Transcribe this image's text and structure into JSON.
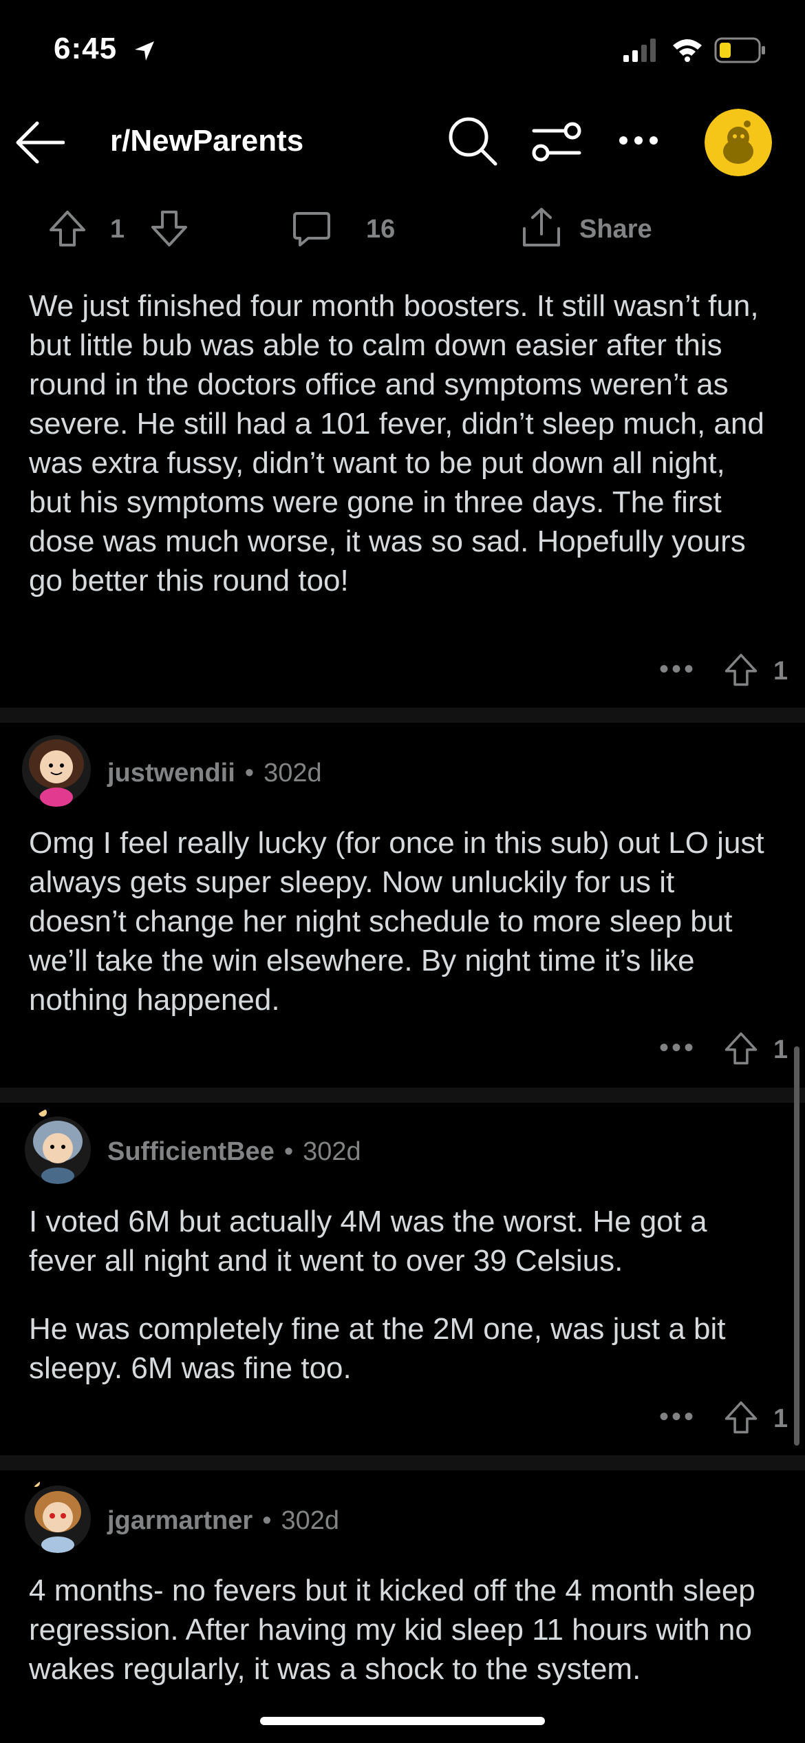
{
  "status_bar": {
    "time": "6:45",
    "icons": [
      "location-arrow-icon",
      "signal-icon",
      "wifi-icon",
      "battery-icon"
    ]
  },
  "header": {
    "back_icon": "back-arrow-icon",
    "title": "r/NewParents",
    "icons": [
      "search-icon",
      "filter-icon",
      "more-icon",
      "avatar"
    ],
    "accent": "#f5c518"
  },
  "post_actions": {
    "upvotes": "1",
    "comments": "16",
    "share_label": "Share"
  },
  "comments": [
    {
      "paragraphs": [
        "We just finished four month boosters. It still wasn’t fun, but little bub was able to calm down easier after this round in the doctors office and symptoms weren’t as severe. He still had a 101 fever, didn’t sleep much, and was extra fussy, didn’t want to be put down all night, but his symptoms were gone in three days. The first dose was much worse, it was so sad. Hopefully yours go better this round too!"
      ],
      "votes": "1",
      "more": "•••"
    },
    {
      "username": "justwendii",
      "age": "302d",
      "paragraphs": [
        "Omg I feel really lucky (for once in this sub) out LO just always gets super sleepy. Now unluckily for us it doesn’t change her night schedule to more sleep but we’ll take the win elsewhere. By night time it’s like nothing happened."
      ],
      "votes": "1",
      "more": "•••"
    },
    {
      "username": "SufficientBee",
      "age": "302d",
      "paragraphs": [
        "I voted 6M but actually 4M was the worst. He got a fever all night and it went to over 39 Celsius.",
        "He was completely fine at the 2M one, was just a bit sleepy. 6M was fine too."
      ],
      "votes": "1",
      "more": "•••"
    },
    {
      "username": "jgarmartner",
      "age": "302d",
      "paragraphs": [
        "4 months- no fevers but it kicked off the 4 month sleep regression. After having my kid sleep 11 hours with no wakes regularly, it was a shock to the system."
      ]
    }
  ],
  "separator": "•"
}
